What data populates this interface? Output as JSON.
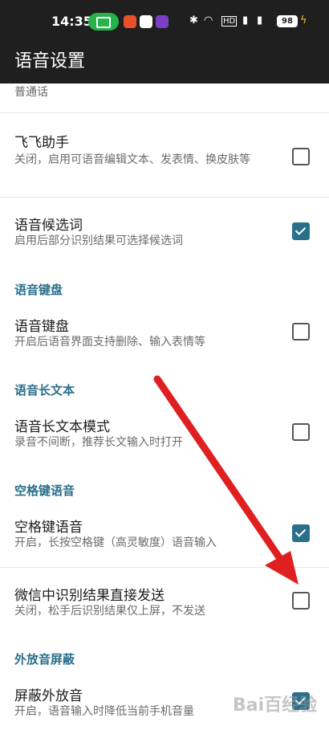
{
  "status": {
    "time": "14:35",
    "battery": "98"
  },
  "appbar": {
    "title": "语音设置"
  },
  "cut_summary": "普通话",
  "items": [
    {
      "title": "飞飞助手",
      "summary": "关闭，启用可语音编辑文本、发表情、换皮肤等",
      "checked": false
    },
    {
      "title": "语音候选词",
      "summary": "启用后部分识别结果可选择候选词",
      "checked": true
    },
    {
      "title": "语音键盘",
      "summary": "开启后语音界面支持删除、输入表情等",
      "checked": false
    },
    {
      "title": "语音长文本模式",
      "summary": "录音不间断，推荐长文输入时打开",
      "checked": false
    },
    {
      "title": "空格键语音",
      "summary": "开启，长按空格键（高灵敏度）语音输入",
      "checked": true
    },
    {
      "title": "微信中识别结果直接发送",
      "summary": "关闭，松手后识别结果仅上屏，不发送",
      "checked": false
    },
    {
      "title": "屏蔽外放音",
      "summary": "开启，语音输入时降低当前手机音量",
      "checked": true
    }
  ],
  "categories": [
    "语音键盘",
    "语音长文本",
    "空格键语音",
    "外放音屏蔽"
  ],
  "watermark": "Bai百经验",
  "colors": {
    "accent": "#2a6f8c",
    "arrow": "#e02020",
    "bar": "#1f1f1f"
  }
}
